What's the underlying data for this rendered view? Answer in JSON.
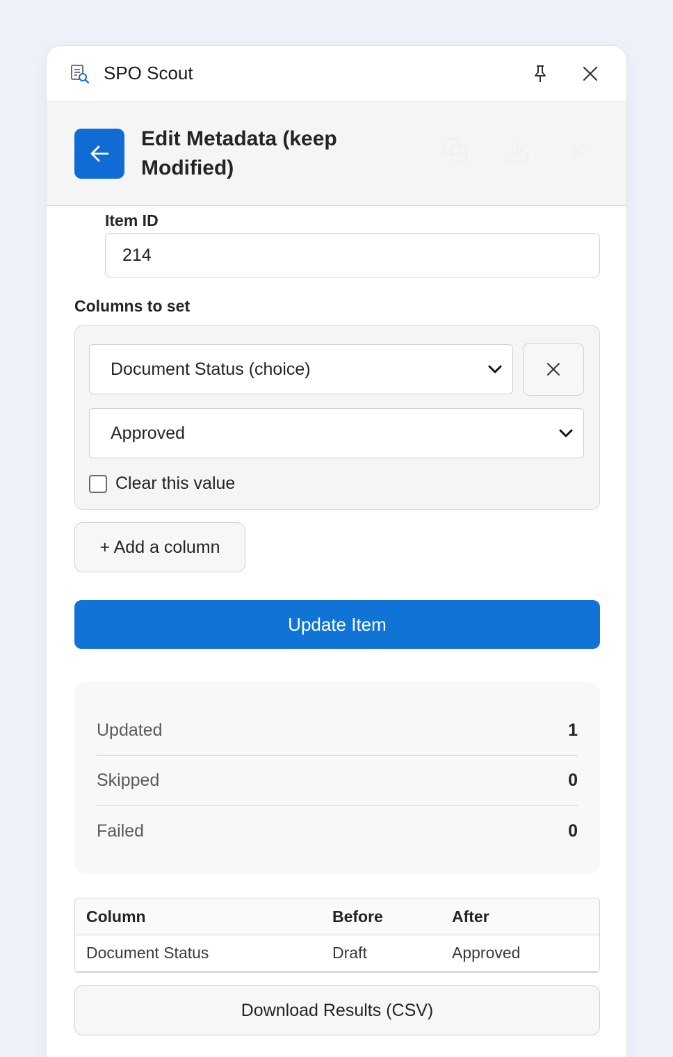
{
  "app": {
    "title": "SPO Scout",
    "icon": "document-search-icon",
    "accent": "#0f6cd4"
  },
  "header": {
    "title": "Edit Metadata (keep Modified)",
    "back_icon": "arrow-left-icon",
    "actions": [
      "copy-icon",
      "download-icon",
      "close-icon"
    ]
  },
  "form": {
    "item_id_label": "Item ID",
    "item_id_value": "214",
    "columns_label": "Columns to set",
    "column_select_value": "Document Status (choice)",
    "value_select_value": "Approved",
    "clear_label": "Clear this value",
    "clear_checked": false,
    "add_column_label": "+ Add a column",
    "submit_label": "Update Item"
  },
  "summary": {
    "rows": [
      {
        "label": "Updated",
        "value": "1"
      },
      {
        "label": "Skipped",
        "value": "0"
      },
      {
        "label": "Failed",
        "value": "0"
      }
    ]
  },
  "results": {
    "headers": [
      "Column",
      "Before",
      "After"
    ],
    "rows": [
      [
        "Document Status",
        "Draft",
        "Approved"
      ]
    ]
  },
  "download_label": "Download Results (CSV)"
}
